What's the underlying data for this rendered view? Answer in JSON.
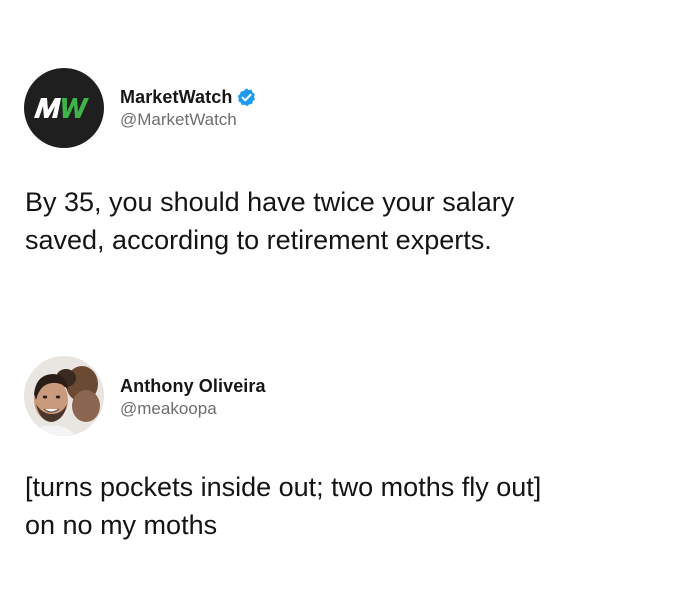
{
  "tweets": [
    {
      "author": {
        "display_name": "MarketWatch",
        "handle": "@MarketWatch",
        "verified": true,
        "avatar_icon": "marketwatch-logo",
        "avatar_logo_text": "MW"
      },
      "text": "By 35, you should have twice your salary\nsaved, according to retirement experts."
    },
    {
      "author": {
        "display_name": "Anthony Oliveira",
        "handle": "@meakoopa",
        "verified": false,
        "avatar_icon": "user-photo-avatar"
      },
      "text": "[turns pockets inside out; two moths fly out]\non no my moths"
    }
  ],
  "colors": {
    "mw_background": "#1f1f1f",
    "mw_white": "#ffffff",
    "mw_green": "#3fb24a",
    "verified_blue": "#1d9bf0",
    "handle_gray": "#6e6e6e",
    "text_dark": "#141414"
  }
}
